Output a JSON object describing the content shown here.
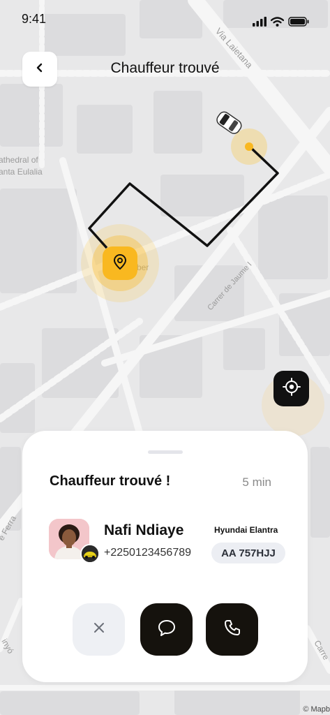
{
  "status_bar": {
    "time": "9:41",
    "icons": [
      "signal-icon",
      "wifi-icon",
      "battery-icon"
    ]
  },
  "header": {
    "back_icon": "chevron-left-icon",
    "title": "Chauffeur trouvé"
  },
  "map": {
    "street_labels": [
      "Via Laietana",
      "Carrer de Jaume I",
      "athedral of",
      "anta Eulalia",
      "ber",
      "e Ferra",
      "inyó",
      "Carre"
    ],
    "pickup_icon": "location-pin-icon",
    "vehicle_icon": "car-icon",
    "locate_icon": "crosshair-icon",
    "copyright": "© Mapb",
    "route_color": "#111111",
    "accent_color": "#f9b820"
  },
  "sheet": {
    "title": "Chauffeur trouvé !",
    "eta": "5 min",
    "driver": {
      "name": "Nafi Ndiaye",
      "phone": "+2250123456789",
      "car_model": "Hyundai Elantra",
      "plate": "AA 757HJJ"
    },
    "actions": {
      "cancel_icon": "close-icon",
      "chat_icon": "chat-bubble-icon",
      "call_icon": "phone-icon"
    }
  }
}
